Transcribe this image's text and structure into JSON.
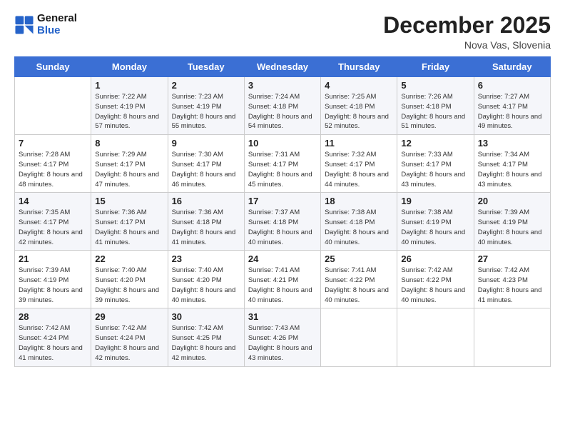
{
  "header": {
    "logo_text_general": "General",
    "logo_text_blue": "Blue",
    "month_title": "December 2025",
    "location": "Nova Vas, Slovenia"
  },
  "weekdays": [
    "Sunday",
    "Monday",
    "Tuesday",
    "Wednesday",
    "Thursday",
    "Friday",
    "Saturday"
  ],
  "weeks": [
    [
      {
        "day": "",
        "detail": ""
      },
      {
        "day": "1",
        "detail": "Sunrise: 7:22 AM\nSunset: 4:19 PM\nDaylight: 8 hours\nand 57 minutes."
      },
      {
        "day": "2",
        "detail": "Sunrise: 7:23 AM\nSunset: 4:19 PM\nDaylight: 8 hours\nand 55 minutes."
      },
      {
        "day": "3",
        "detail": "Sunrise: 7:24 AM\nSunset: 4:18 PM\nDaylight: 8 hours\nand 54 minutes."
      },
      {
        "day": "4",
        "detail": "Sunrise: 7:25 AM\nSunset: 4:18 PM\nDaylight: 8 hours\nand 52 minutes."
      },
      {
        "day": "5",
        "detail": "Sunrise: 7:26 AM\nSunset: 4:18 PM\nDaylight: 8 hours\nand 51 minutes."
      },
      {
        "day": "6",
        "detail": "Sunrise: 7:27 AM\nSunset: 4:17 PM\nDaylight: 8 hours\nand 49 minutes."
      }
    ],
    [
      {
        "day": "7",
        "detail": "Sunrise: 7:28 AM\nSunset: 4:17 PM\nDaylight: 8 hours\nand 48 minutes."
      },
      {
        "day": "8",
        "detail": "Sunrise: 7:29 AM\nSunset: 4:17 PM\nDaylight: 8 hours\nand 47 minutes."
      },
      {
        "day": "9",
        "detail": "Sunrise: 7:30 AM\nSunset: 4:17 PM\nDaylight: 8 hours\nand 46 minutes."
      },
      {
        "day": "10",
        "detail": "Sunrise: 7:31 AM\nSunset: 4:17 PM\nDaylight: 8 hours\nand 45 minutes."
      },
      {
        "day": "11",
        "detail": "Sunrise: 7:32 AM\nSunset: 4:17 PM\nDaylight: 8 hours\nand 44 minutes."
      },
      {
        "day": "12",
        "detail": "Sunrise: 7:33 AM\nSunset: 4:17 PM\nDaylight: 8 hours\nand 43 minutes."
      },
      {
        "day": "13",
        "detail": "Sunrise: 7:34 AM\nSunset: 4:17 PM\nDaylight: 8 hours\nand 43 minutes."
      }
    ],
    [
      {
        "day": "14",
        "detail": "Sunrise: 7:35 AM\nSunset: 4:17 PM\nDaylight: 8 hours\nand 42 minutes."
      },
      {
        "day": "15",
        "detail": "Sunrise: 7:36 AM\nSunset: 4:17 PM\nDaylight: 8 hours\nand 41 minutes."
      },
      {
        "day": "16",
        "detail": "Sunrise: 7:36 AM\nSunset: 4:18 PM\nDaylight: 8 hours\nand 41 minutes."
      },
      {
        "day": "17",
        "detail": "Sunrise: 7:37 AM\nSunset: 4:18 PM\nDaylight: 8 hours\nand 40 minutes."
      },
      {
        "day": "18",
        "detail": "Sunrise: 7:38 AM\nSunset: 4:18 PM\nDaylight: 8 hours\nand 40 minutes."
      },
      {
        "day": "19",
        "detail": "Sunrise: 7:38 AM\nSunset: 4:19 PM\nDaylight: 8 hours\nand 40 minutes."
      },
      {
        "day": "20",
        "detail": "Sunrise: 7:39 AM\nSunset: 4:19 PM\nDaylight: 8 hours\nand 40 minutes."
      }
    ],
    [
      {
        "day": "21",
        "detail": "Sunrise: 7:39 AM\nSunset: 4:19 PM\nDaylight: 8 hours\nand 39 minutes."
      },
      {
        "day": "22",
        "detail": "Sunrise: 7:40 AM\nSunset: 4:20 PM\nDaylight: 8 hours\nand 39 minutes."
      },
      {
        "day": "23",
        "detail": "Sunrise: 7:40 AM\nSunset: 4:20 PM\nDaylight: 8 hours\nand 40 minutes."
      },
      {
        "day": "24",
        "detail": "Sunrise: 7:41 AM\nSunset: 4:21 PM\nDaylight: 8 hours\nand 40 minutes."
      },
      {
        "day": "25",
        "detail": "Sunrise: 7:41 AM\nSunset: 4:22 PM\nDaylight: 8 hours\nand 40 minutes."
      },
      {
        "day": "26",
        "detail": "Sunrise: 7:42 AM\nSunset: 4:22 PM\nDaylight: 8 hours\nand 40 minutes."
      },
      {
        "day": "27",
        "detail": "Sunrise: 7:42 AM\nSunset: 4:23 PM\nDaylight: 8 hours\nand 41 minutes."
      }
    ],
    [
      {
        "day": "28",
        "detail": "Sunrise: 7:42 AM\nSunset: 4:24 PM\nDaylight: 8 hours\nand 41 minutes."
      },
      {
        "day": "29",
        "detail": "Sunrise: 7:42 AM\nSunset: 4:24 PM\nDaylight: 8 hours\nand 42 minutes."
      },
      {
        "day": "30",
        "detail": "Sunrise: 7:42 AM\nSunset: 4:25 PM\nDaylight: 8 hours\nand 42 minutes."
      },
      {
        "day": "31",
        "detail": "Sunrise: 7:43 AM\nSunset: 4:26 PM\nDaylight: 8 hours\nand 43 minutes."
      },
      {
        "day": "",
        "detail": ""
      },
      {
        "day": "",
        "detail": ""
      },
      {
        "day": "",
        "detail": ""
      }
    ]
  ]
}
